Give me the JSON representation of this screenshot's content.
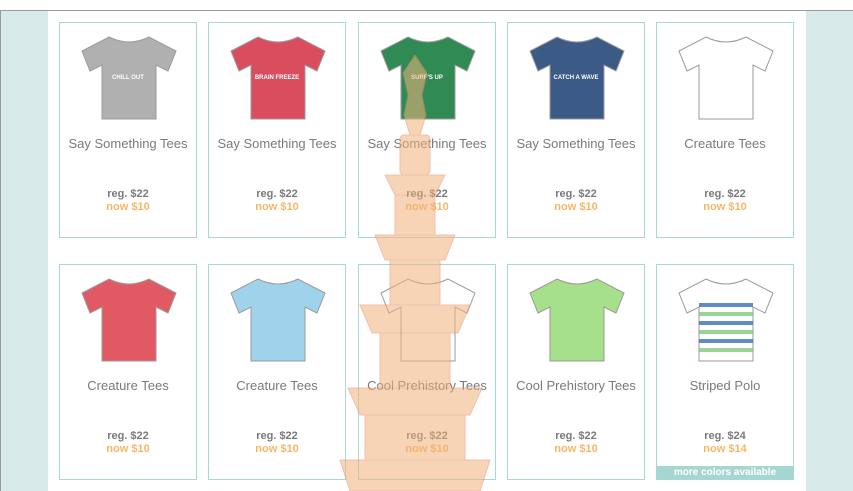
{
  "products": [
    {
      "name": "Say Something Tees",
      "reg": "reg. $22",
      "now": "now $10",
      "shirt_color": "#b0b0b0",
      "graphic": "CHILL OUT"
    },
    {
      "name": "Say Something Tees",
      "reg": "reg. $22",
      "now": "now $10",
      "shirt_color": "#d94d5e",
      "graphic": "BRAIN FREEZE"
    },
    {
      "name": "Say Something Tees",
      "reg": "reg. $22",
      "now": "now $10",
      "shirt_color": "#2f8a53",
      "graphic": "SURF'S UP"
    },
    {
      "name": "Say Something Tees",
      "reg": "reg. $22",
      "now": "now $10",
      "shirt_color": "#3b5a86",
      "graphic": "CATCH A WAVE"
    },
    {
      "name": "Creature Tees",
      "reg": "reg. $22",
      "now": "now $10",
      "shirt_color": "#ffffff",
      "graphic": ""
    },
    {
      "name": "Creature Tees",
      "reg": "reg. $22",
      "now": "now $10",
      "shirt_color": "#e15a63",
      "graphic": ""
    },
    {
      "name": "Creature Tees",
      "reg": "reg. $22",
      "now": "now $10",
      "shirt_color": "#9fd3ec",
      "graphic": ""
    },
    {
      "name": "Cool Prehistory Tees",
      "reg": "reg. $22",
      "now": "now $10",
      "shirt_color": "#ffffff",
      "graphic": ""
    },
    {
      "name": "Cool Prehistory Tees",
      "reg": "reg. $22",
      "now": "now $10",
      "shirt_color": "#a7e08a",
      "graphic": ""
    },
    {
      "name": "Striped Polo",
      "reg": "reg. $24",
      "now": "now $14",
      "shirt_color": "#ffffff",
      "graphic": "",
      "more": "more colors available"
    }
  ],
  "colors": {
    "accent": "#f6b765",
    "border": "#a7d9d3",
    "side": "#d8ebea"
  }
}
